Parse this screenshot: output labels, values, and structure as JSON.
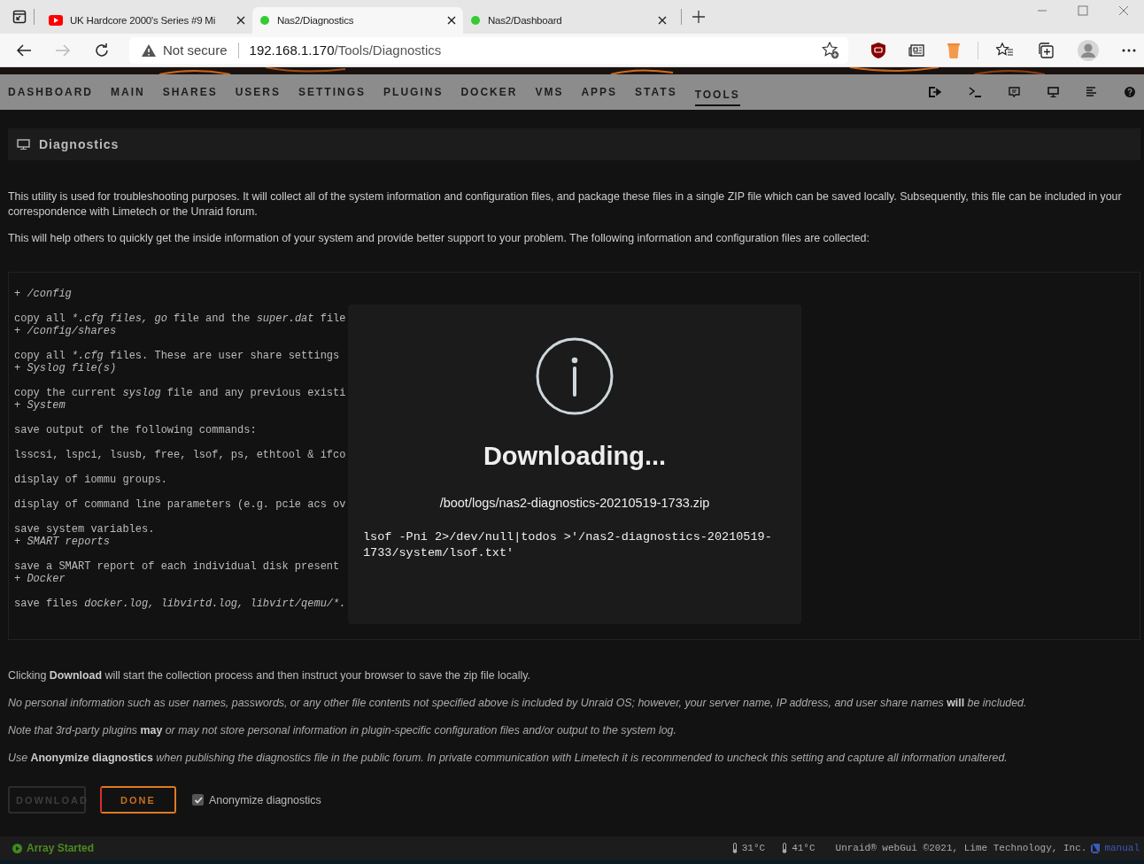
{
  "browser": {
    "tabs": [
      {
        "title": "UK Hardcore 2000's Series #9 Mi",
        "kind": "video",
        "selected": false
      },
      {
        "title": "Nas2/Diagnostics",
        "kind": "server",
        "selected": true
      },
      {
        "title": "Nas2/Dashboard",
        "kind": "server",
        "selected": false
      }
    ],
    "security": "Not secure",
    "url_host": "192.168.1.170",
    "url_path": "/Tools/Diagnostics"
  },
  "nav": {
    "items": [
      {
        "label": "DASHBOARD",
        "selected": false
      },
      {
        "label": "MAIN",
        "selected": false
      },
      {
        "label": "SHARES",
        "selected": false
      },
      {
        "label": "USERS",
        "selected": false
      },
      {
        "label": "SETTINGS",
        "selected": false
      },
      {
        "label": "PLUGINS",
        "selected": false
      },
      {
        "label": "DOCKER",
        "selected": false
      },
      {
        "label": "VMS",
        "selected": false
      },
      {
        "label": "APPS",
        "selected": false
      },
      {
        "label": "STATS",
        "selected": false
      },
      {
        "label": "TOOLS",
        "selected": true
      }
    ]
  },
  "page": {
    "title": "Diagnostics",
    "intro": [
      "This utility is used for troubleshooting purposes. It will collect all of the system information and configuration files, and package these files in a single ZIP file which can be saved locally. Subsequently, this file can be included in your correspondence with Limetech or the Unraid forum.",
      "This will help others to quickly get the inside information of your system and provide better support to your problem. The following information and configuration files are collected:"
    ],
    "file_list": [
      {
        "kind": "heading",
        "marker": "+",
        "parts": [
          {
            "text": "/config",
            "italic": true
          }
        ]
      },
      {
        "kind": "text",
        "parts": [
          {
            "text": "copy all ",
            "italic": false
          },
          {
            "text": "*.cfg files, go",
            "italic": true
          },
          {
            "text": " file and the ",
            "italic": false
          },
          {
            "text": "super.dat",
            "italic": true
          },
          {
            "text": " file",
            "italic": false
          }
        ]
      },
      {
        "kind": "heading",
        "marker": "+",
        "parts": [
          {
            "text": "/config/shares",
            "italic": true
          }
        ]
      },
      {
        "kind": "text",
        "parts": [
          {
            "text": "copy all ",
            "italic": false
          },
          {
            "text": "*.cfg",
            "italic": true
          },
          {
            "text": " files. These are user share settings",
            "italic": false
          }
        ]
      },
      {
        "kind": "heading",
        "marker": "+",
        "parts": [
          {
            "text": "Syslog file(s)",
            "italic": true
          }
        ]
      },
      {
        "kind": "text",
        "parts": [
          {
            "text": "copy the current ",
            "italic": false
          },
          {
            "text": "syslog",
            "italic": true
          },
          {
            "text": " file and any previous existi",
            "italic": false
          }
        ]
      },
      {
        "kind": "heading",
        "marker": "+",
        "parts": [
          {
            "text": "System",
            "italic": true
          }
        ]
      },
      {
        "kind": "text",
        "parts": [
          {
            "text": "save output of the following commands:",
            "italic": false
          }
        ]
      },
      {
        "kind": "text",
        "parts": [
          {
            "text": "lsscsi, lspci, lsusb, free, lsof, ps, ethtool & ifco",
            "italic": false
          }
        ]
      },
      {
        "kind": "text",
        "parts": [
          {
            "text": "display of iommu groups.",
            "italic": false
          }
        ]
      },
      {
        "kind": "text",
        "parts": [
          {
            "text": "display of command line parameters (e.g. pcie acs ov",
            "italic": false
          }
        ]
      },
      {
        "kind": "text",
        "parts": [
          {
            "text": "save system variables.",
            "italic": false
          }
        ]
      },
      {
        "kind": "heading",
        "marker": "+",
        "parts": [
          {
            "text": "SMART reports",
            "italic": true
          }
        ]
      },
      {
        "kind": "text",
        "parts": [
          {
            "text": "save a SMART report of each individual disk present",
            "italic": false
          }
        ]
      },
      {
        "kind": "heading",
        "marker": "+",
        "parts": [
          {
            "text": "Docker",
            "italic": true
          }
        ]
      },
      {
        "kind": "text",
        "parts": [
          {
            "text": "save files ",
            "italic": false
          },
          {
            "text": "docker.log, libvirtd.log, libvirt/qemu/*.",
            "italic": true
          }
        ]
      }
    ],
    "notes": [
      {
        "kind": "plain",
        "text": "Clicking **Download** will start the collection process and then instruct your browser to save the zip file locally."
      },
      {
        "kind": "italic",
        "text": "No personal information such as user names, passwords, or any other file contents not specified above is included by Unraid OS; however, your server name, IP address, and user share names **will** be included."
      },
      {
        "kind": "italic",
        "text": "Note that 3rd-party plugins **may** or may not store personal information in plugin-specific configuration files and/or output to the system log."
      },
      {
        "kind": "italic",
        "text": "Use **Anonymize diagnostics** when publishing the diagnostics file in the public forum. In private communication with Limetech it is recommended to uncheck this setting and capture all information unaltered."
      }
    ],
    "buttons": [
      {
        "label": "DOWNLOAD",
        "disabled": true
      },
      {
        "label": "DONE",
        "disabled": false
      }
    ],
    "anonymize": {
      "label": "Anonymize diagnostics",
      "checked": true
    }
  },
  "modal": {
    "title": "Downloading...",
    "path": "/boot/logs/nas2-diagnostics-20210519-1733.zip",
    "command": "lsof -Pni 2>/dev/null|todos >'/nas2-diagnostics-20210519-1733/system/lsof.txt'"
  },
  "status_bar": {
    "array": "Array Started",
    "temps": [
      "31°C",
      "41°C"
    ],
    "copyright": "Unraid® webGui ©2021, Lime Technology, Inc.",
    "manual": "manual"
  }
}
